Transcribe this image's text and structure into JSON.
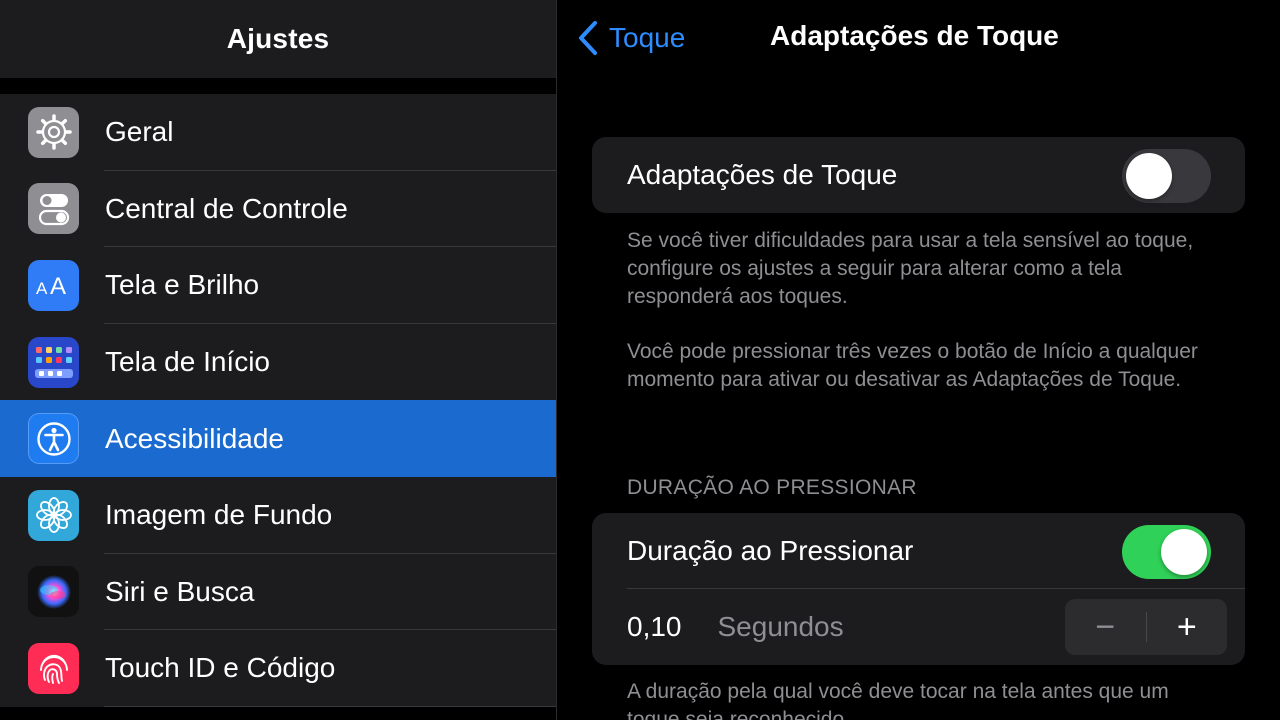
{
  "sidebar": {
    "title": "Ajustes",
    "items": [
      {
        "label": "Geral",
        "icon": "gear-icon"
      },
      {
        "label": "Central de Controle",
        "icon": "toggles-icon"
      },
      {
        "label": "Tela e Brilho",
        "icon": "text-size-icon"
      },
      {
        "label": "Tela de Início",
        "icon": "home-grid-icon"
      },
      {
        "label": "Acessibilidade",
        "icon": "accessibility-icon",
        "selected": true
      },
      {
        "label": "Imagem de Fundo",
        "icon": "flower-icon"
      },
      {
        "label": "Siri e Busca",
        "icon": "siri-icon"
      },
      {
        "label": "Touch ID e Código",
        "icon": "fingerprint-icon"
      }
    ]
  },
  "nav": {
    "back_label": "Toque",
    "title": "Adaptações de Toque"
  },
  "touch_accommodations": {
    "label": "Adaptações de Toque",
    "enabled": false,
    "footer_1": "Se você tiver dificuldades para usar a tela sensível ao toque, configure os ajustes a seguir para alterar como a tela responderá aos toques.",
    "footer_2": "Você pode pressionar três vezes o botão de Início a qualquer momento para ativar ou desativar as Adaptações de Toque."
  },
  "hold_duration": {
    "section_header": "DURAÇÃO AO PRESSIONAR",
    "label": "Duração ao Pressionar",
    "enabled": true,
    "value": "0,10",
    "unit": "Segundos",
    "minus": "−",
    "plus": "+",
    "footer": "A duração pela qual você deve tocar na tela antes que um toque seja reconhecido."
  },
  "colors": {
    "accent": "#2f8cff",
    "selected_row": "#1a6ad0",
    "switch_on": "#30d158",
    "switch_off": "#39393d"
  }
}
